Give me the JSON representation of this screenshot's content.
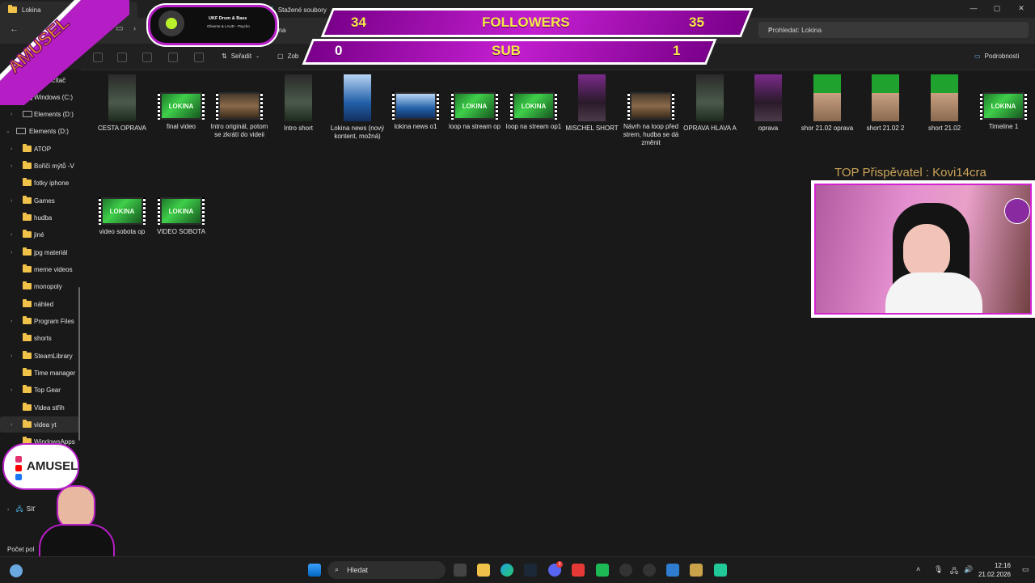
{
  "window": {
    "tabs": [
      "Lokina",
      "Stažené soubory"
    ],
    "controls": [
      "—",
      "▢",
      "✕"
    ]
  },
  "address": {
    "path_end": "kina",
    "search_placeholder": "Prohledat: Lokina"
  },
  "toolbar": {
    "sort_label": "Seřadit",
    "view_label": "Zob",
    "details_label": "Podrobnosti"
  },
  "sidebar": {
    "items": [
      {
        "label": "nto počítač",
        "type": "pc"
      },
      {
        "label": "Windows (C:)",
        "type": "drive"
      },
      {
        "label": "Elements (D:)",
        "type": "drive"
      },
      {
        "label": "Elements (D:)",
        "type": "drive-open"
      },
      {
        "label": "ATOP",
        "type": "folder"
      },
      {
        "label": "Bořiči mýtů -V",
        "type": "folder"
      },
      {
        "label": "fotky iphone",
        "type": "folder"
      },
      {
        "label": "Games",
        "type": "folder"
      },
      {
        "label": "hudba",
        "type": "folder"
      },
      {
        "label": "jiné",
        "type": "folder"
      },
      {
        "label": "jpg materiál",
        "type": "folder"
      },
      {
        "label": "meme videos",
        "type": "folder"
      },
      {
        "label": "monopoly",
        "type": "folder"
      },
      {
        "label": "náhled",
        "type": "folder"
      },
      {
        "label": "Program Files",
        "type": "folder"
      },
      {
        "label": "shorts",
        "type": "folder"
      },
      {
        "label": "SteamLibrary",
        "type": "folder"
      },
      {
        "label": "Time manager",
        "type": "folder"
      },
      {
        "label": "Top Gear",
        "type": "folder"
      },
      {
        "label": "Videa střih",
        "type": "folder"
      },
      {
        "label": "videa yt",
        "type": "folder"
      },
      {
        "label": "WindowsApps",
        "type": "folder"
      }
    ],
    "network_label": "Síť",
    "status_label": "Počet pol"
  },
  "files": [
    {
      "name": "CESTA OPRAVA",
      "kind": "v",
      "style": "g-dark"
    },
    {
      "name": "final video",
      "kind": "h",
      "style": "g-lokina"
    },
    {
      "name": "Intro originál, potom se zkrátí do videii",
      "kind": "h",
      "style": "g-brown"
    },
    {
      "name": "Intro short",
      "kind": "v",
      "style": "g-dark"
    },
    {
      "name": "Lokina news (nový kontent, možná)",
      "kind": "v",
      "style": "g-news"
    },
    {
      "name": "lokina news o1",
      "kind": "h",
      "style": "g-news"
    },
    {
      "name": "loop na stream op",
      "kind": "h",
      "style": "g-lokina"
    },
    {
      "name": "loop na stream op1",
      "kind": "h",
      "style": "g-lokina"
    },
    {
      "name": "MISCHEL SHORT",
      "kind": "v",
      "style": "g-purple"
    },
    {
      "name": "Návrh na loop před strem, hudba se dá změnit",
      "kind": "h",
      "style": "g-brown"
    },
    {
      "name": "OPRAVA HLAVA A",
      "kind": "v",
      "style": "g-dark"
    },
    {
      "name": "oprava",
      "kind": "v",
      "style": "g-purple"
    },
    {
      "name": "shor  21.02 oprava",
      "kind": "v",
      "style": "g-face"
    },
    {
      "name": "short 21.02 2",
      "kind": "v",
      "style": "g-face"
    },
    {
      "name": "short 21.02",
      "kind": "v",
      "style": "g-face"
    },
    {
      "name": "Timeline 1",
      "kind": "h",
      "style": "g-lokina"
    },
    {
      "name": "video sobota op",
      "kind": "h",
      "style": "g-lokina"
    },
    {
      "name": "VIDEO SOBOTA",
      "kind": "h",
      "style": "g-lokina"
    }
  ],
  "overlay": {
    "logo_text": "AMUSEL",
    "music_title": "UKF Drum & Bass",
    "music_artist": "Oliverse & LAUD - Psycho",
    "followers_label": "FOLLOWERS",
    "followers_current": "34",
    "followers_goal": "35",
    "sub_label": "SUB",
    "sub_current": "0",
    "sub_goal": "1",
    "top_donor": "TOP Přispěvatel : Kovi14cra",
    "badge_text": "AMUSEL"
  },
  "taskbar": {
    "search_label": "Hledat",
    "time": "12:16",
    "date": "21.02.2026",
    "discord_badge": "3"
  },
  "colors": {
    "accent_purple": "#b51ec5",
    "bar_text": "#f5e94a",
    "folder": "#f0c24a"
  }
}
